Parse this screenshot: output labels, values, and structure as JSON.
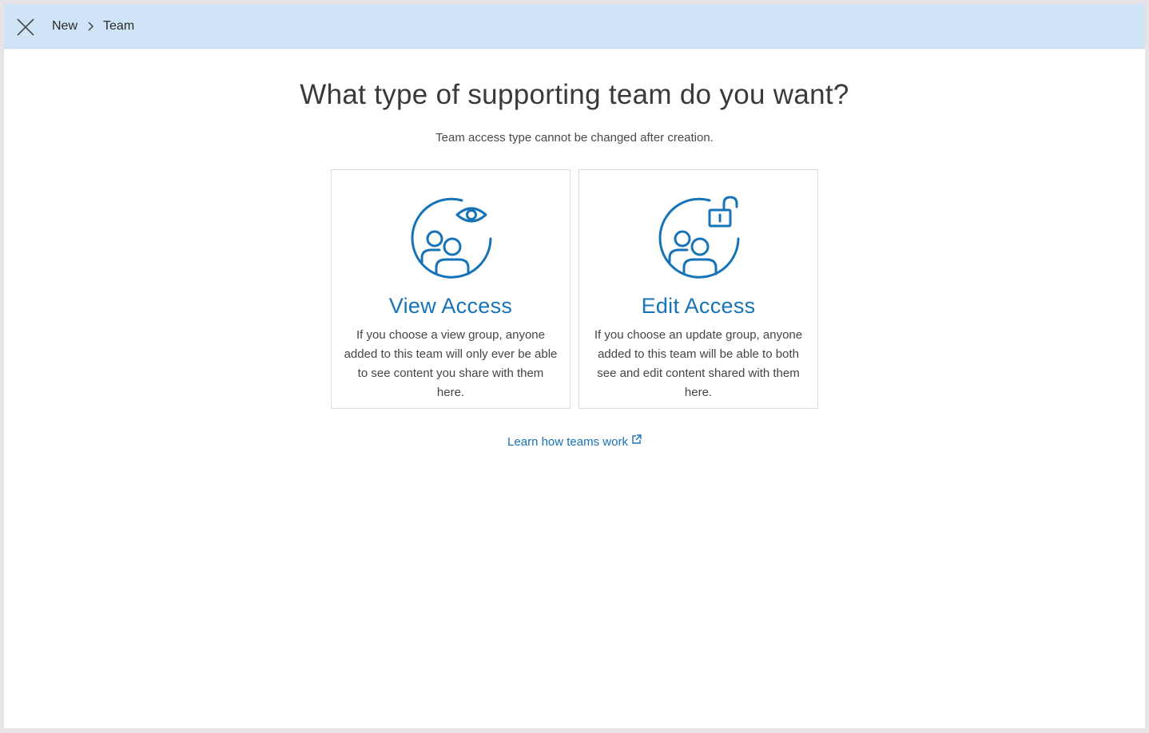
{
  "header": {
    "close_icon": "close-icon",
    "breadcrumb": [
      "New",
      "Team"
    ],
    "separator_icon": "chevron-right-icon"
  },
  "main": {
    "title": "What type of supporting team do you want?",
    "subtitle": "Team access type cannot be changed after creation.",
    "cards": [
      {
        "icon": "team-view-icon",
        "title": "View Access",
        "description": "If you choose a view group, anyone added to this team will only ever be able to see content you share with them here."
      },
      {
        "icon": "team-edit-icon",
        "title": "Edit Access",
        "description": "If you choose an update group, anyone added to this team will be able to both see and edit content shared with them here."
      }
    ],
    "learn_link": "Learn how teams work",
    "learn_link_icon": "external-link-icon"
  },
  "colors": {
    "accent": "#1673b8",
    "topbar": "#cfe5f7",
    "text": "#3a3a3a"
  }
}
